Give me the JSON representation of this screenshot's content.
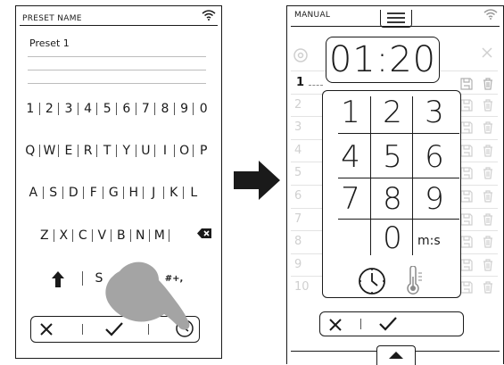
{
  "left_screen": {
    "title": "PRESET NAME",
    "name_value": "Preset 1",
    "keyboard": {
      "row_digits": [
        "1",
        "2",
        "3",
        "4",
        "5",
        "6",
        "7",
        "8",
        "9",
        "0"
      ],
      "row_q": [
        "Q",
        "W",
        "E",
        "R",
        "T",
        "Y",
        "U",
        "I",
        "O",
        "P"
      ],
      "row_a": [
        "A",
        "S",
        "D",
        "F",
        "G",
        "H",
        "J",
        "K",
        "L"
      ],
      "row_z": [
        "Z",
        "X",
        "C",
        "V",
        "B",
        "N",
        "M"
      ],
      "space_partial": "S",
      "symbols_key": "#+,"
    },
    "icons": {
      "wifi": "wifi-icon",
      "backspace": "backspace-icon",
      "shift": "shift-arrow-icon",
      "cancel": "close-icon",
      "confirm": "checkmark-icon",
      "timer": "clock-icon",
      "hand": "tapping-hand-icon"
    }
  },
  "arrow": {
    "icon": "right-arrow-icon"
  },
  "right_screen": {
    "title": "MANUAL",
    "display_time": "01:20",
    "active_row_number": "1",
    "row_numbers": [
      "2",
      "3",
      "4",
      "5",
      "6",
      "7",
      "8",
      "9",
      "10"
    ],
    "keypad": {
      "row1": [
        "1",
        "2",
        "3"
      ],
      "row2": [
        "4",
        "5",
        "6"
      ],
      "row3": [
        "7",
        "8",
        "9"
      ],
      "zero": "0",
      "unit_label": "m:s"
    },
    "icons": {
      "wifi": "wifi-icon",
      "menu": "hamburger-menu-icon",
      "close": "close-icon",
      "clock": "clock-icon",
      "probe": "temperature-probe-icon",
      "cancel": "close-icon",
      "confirm": "checkmark-icon",
      "scroll_up": "up-triangle-icon"
    }
  }
}
